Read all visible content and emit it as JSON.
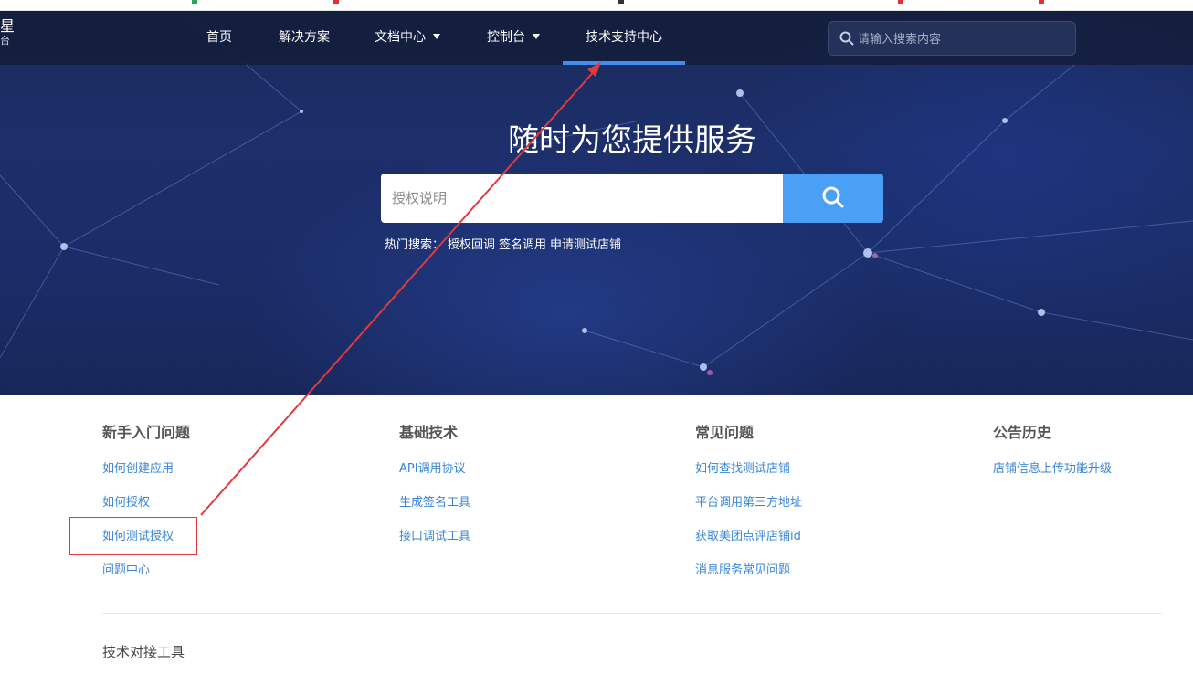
{
  "logo": {
    "main": "星",
    "sub": "台"
  },
  "nav": {
    "items": [
      {
        "label": "首页"
      },
      {
        "label": "解决方案"
      },
      {
        "label": "文档中心"
      },
      {
        "label": "控制台"
      },
      {
        "label": "技术支持中心"
      }
    ],
    "search_placeholder": "请输入搜索内容"
  },
  "hero": {
    "title": "随时为您提供服务",
    "search_value": "",
    "search_placeholder": "授权说明",
    "hot_label": "热门搜索：",
    "hot_items": [
      "授权回调",
      "签名调用",
      "申请测试店铺"
    ]
  },
  "sections": [
    {
      "title": "新手入门问题",
      "links": [
        "如何创建应用",
        "如何授权",
        "如何测试授权",
        "问题中心"
      ]
    },
    {
      "title": "基础技术",
      "links": [
        "API调用协议",
        "生成签名工具",
        "接口调试工具"
      ]
    },
    {
      "title": "常见问题",
      "links": [
        "如何查找测试店铺",
        "平台调用第三方地址",
        "获取美团点评店铺id",
        "消息服务常见问题"
      ]
    },
    {
      "title": "公告历史",
      "links": [
        "店铺信息上传功能升级"
      ]
    }
  ],
  "bottom_title": "技术对接工具",
  "colors": {
    "nav_bg": "#141e3e",
    "accent": "#3d8ef0",
    "search_btn": "#4aa0f5",
    "link": "#3a86d4",
    "annotation": "#e23a3a"
  }
}
